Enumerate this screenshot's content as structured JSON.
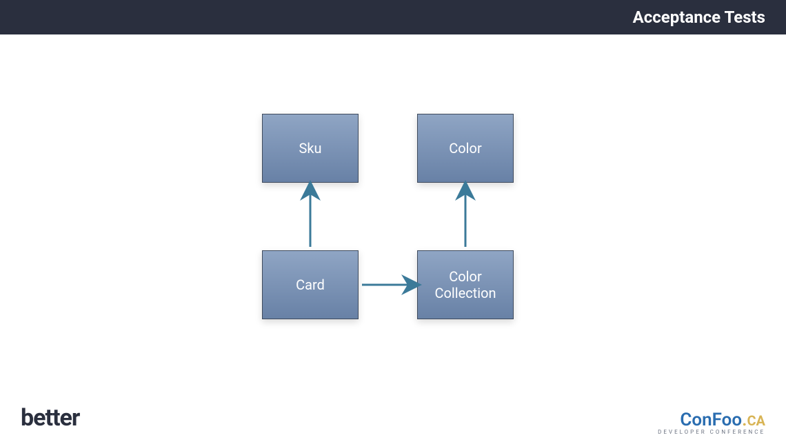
{
  "header": {
    "title": "Acceptance Tests"
  },
  "diagram": {
    "boxes": {
      "sku": "Sku",
      "color": "Color",
      "card": "Card",
      "colorCollection": "Color Collection"
    },
    "arrows": [
      {
        "from": "card",
        "to": "sku",
        "direction": "up"
      },
      {
        "from": "card",
        "to": "colorCollection",
        "direction": "right"
      },
      {
        "from": "colorCollection",
        "to": "color",
        "direction": "up"
      }
    ],
    "colors": {
      "boxFillTop": "#8fa5c4",
      "boxFillBottom": "#6881a6",
      "boxBorder": "#3e4a5c",
      "arrow": "#3b7a99"
    }
  },
  "footer": {
    "left": "better",
    "right": {
      "con": "Con",
      "foo": "Foo",
      "dot": ".",
      "ca": "CA",
      "sub": "DEVELOPER CONFERENCE"
    }
  }
}
